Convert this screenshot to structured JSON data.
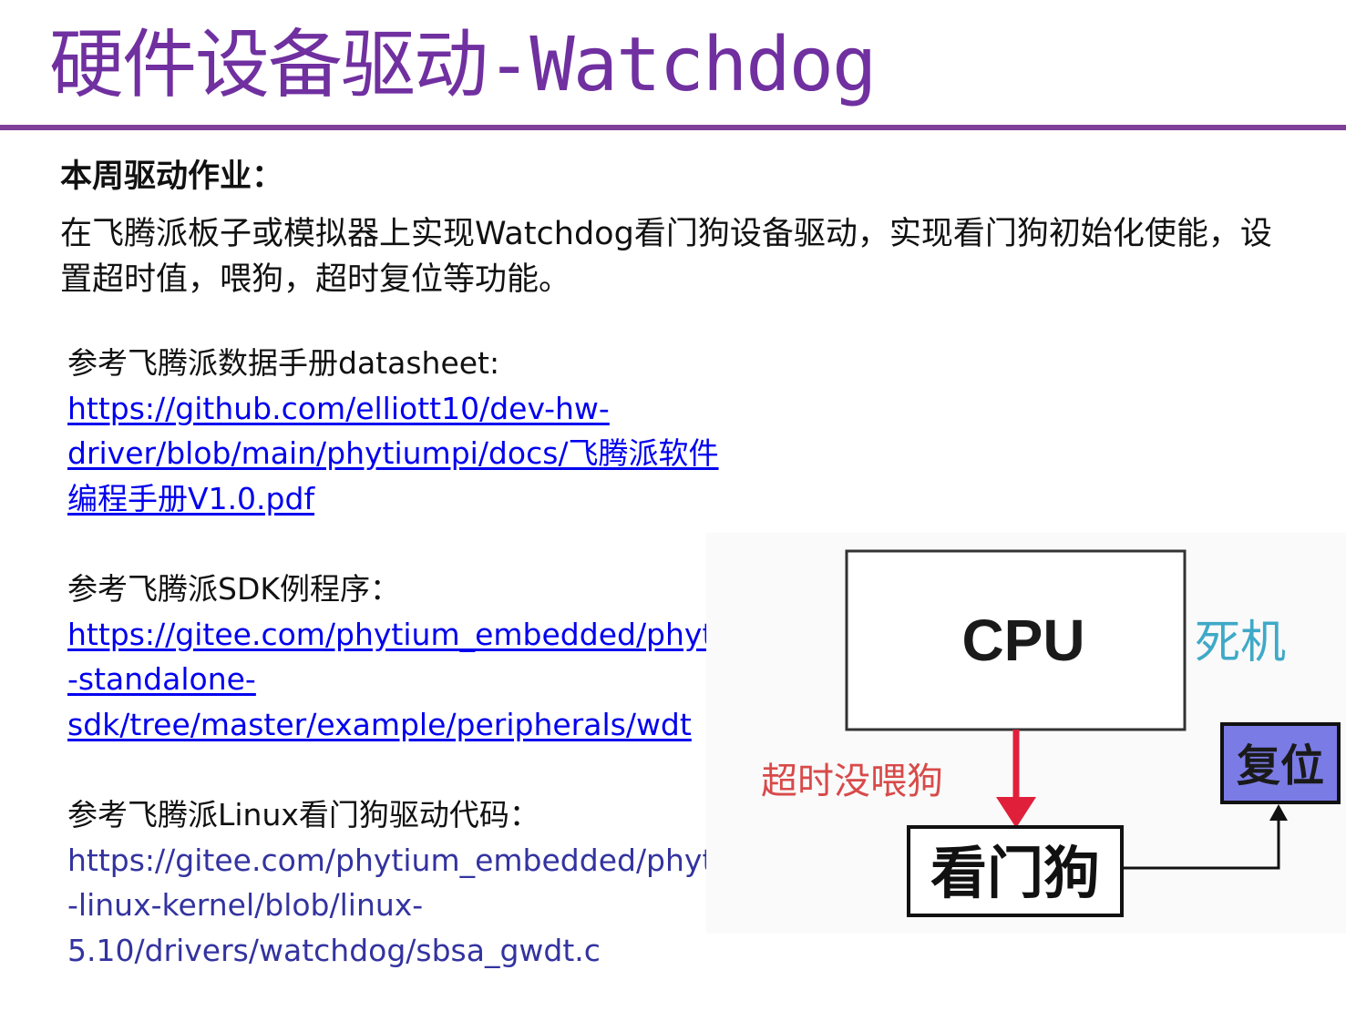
{
  "slide": {
    "title": "硬件设备驱动-Watchdog"
  },
  "homework": {
    "heading": "本周驱动作业：",
    "description": "在飞腾派板子或模拟器上实现Watchdog看门狗设备驱动，实现看门狗初始化使能，设置超时值，喂狗，超时复位等功能。"
  },
  "references": [
    {
      "label": "参考飞腾派数据手册datasheet:",
      "lines": [
        "https://github.com/elliott10/dev-hw-",
        "driver/blob/main/phytiumpi/docs/飞腾派软件",
        "编程手册V1.0.pdf"
      ]
    },
    {
      "label": "参考飞腾派SDK例程序：",
      "lines": [
        "https://gitee.com/phytium_embedded/phytium",
        "-standalone-",
        "sdk/tree/master/example/peripherals/wdt"
      ]
    },
    {
      "label": "参考飞腾派Linux看门狗驱动代码：",
      "lines": [
        "https://gitee.com/phytium_embedded/phytium",
        "-linux-kernel/blob/linux-",
        "5.10/drivers/watchdog/sbsa_gwdt.c"
      ]
    }
  ],
  "diagram": {
    "cpu_label": "CPU",
    "hang_label": "死机",
    "timeout_label": "超时没喂狗",
    "watchdog_label": "看门狗",
    "reset_label": "复位",
    "colors": {
      "hang": "#3FA9C8",
      "timeout": "#D84A4A",
      "arrow_red": "#E0203A",
      "reset_fill": "#7B7BE6"
    }
  }
}
